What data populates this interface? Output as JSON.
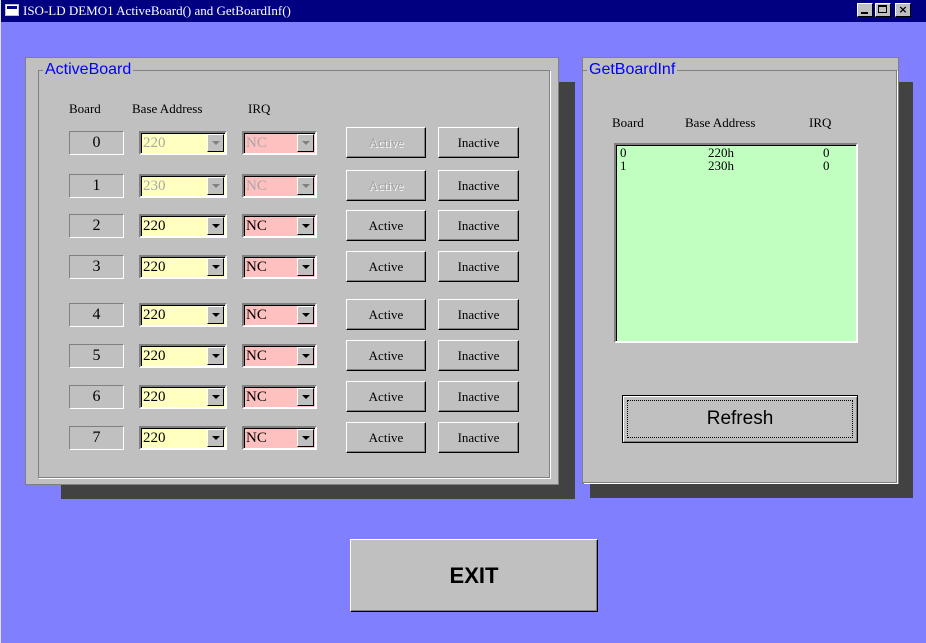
{
  "window": {
    "title": "ISO-LD DEMO1 ActiveBoard() and GetBoardInf()",
    "controls": {
      "minimize": "",
      "maximize": "",
      "close": "×"
    }
  },
  "active_board": {
    "legend": "ActiveBoard",
    "headers": {
      "board": "Board",
      "base_address": "Base Address",
      "irq": "IRQ"
    },
    "rows": [
      {
        "board": "0",
        "address": "220",
        "irq": "NC",
        "active_label": "Active",
        "inactive_label": "Inactive",
        "enabled": false
      },
      {
        "board": "1",
        "address": "230",
        "irq": "NC",
        "active_label": "Active",
        "inactive_label": "Inactive",
        "enabled": false
      },
      {
        "board": "2",
        "address": "220",
        "irq": "NC",
        "active_label": "Active",
        "inactive_label": "Inactive",
        "enabled": true
      },
      {
        "board": "3",
        "address": "220",
        "irq": "NC",
        "active_label": "Active",
        "inactive_label": "Inactive",
        "enabled": true
      },
      {
        "board": "4",
        "address": "220",
        "irq": "NC",
        "active_label": "Active",
        "inactive_label": "Inactive",
        "enabled": true
      },
      {
        "board": "5",
        "address": "220",
        "irq": "NC",
        "active_label": "Active",
        "inactive_label": "Inactive",
        "enabled": true
      },
      {
        "board": "6",
        "address": "220",
        "irq": "NC",
        "active_label": "Active",
        "inactive_label": "Inactive",
        "enabled": true
      },
      {
        "board": "7",
        "address": "220",
        "irq": "NC",
        "active_label": "Active",
        "inactive_label": "Inactive",
        "enabled": true
      }
    ]
  },
  "get_board_inf": {
    "legend": "GetBoardInf",
    "headers": {
      "board": "Board",
      "base_address": "Base Address",
      "irq": "IRQ"
    },
    "list": [
      {
        "board": "0",
        "address": "220h",
        "irq": "0"
      },
      {
        "board": "1",
        "address": "230h",
        "irq": "0"
      }
    ],
    "refresh_label": "Refresh"
  },
  "exit_label": "EXIT",
  "colors": {
    "background": "#8080ff",
    "panel": "#c0c0c0",
    "legend_text": "#0000ff",
    "address_combo": "#ffffc0",
    "irq_combo": "#ffc0c0",
    "list_background": "#c0ffc0",
    "titlebar": "#000080"
  }
}
